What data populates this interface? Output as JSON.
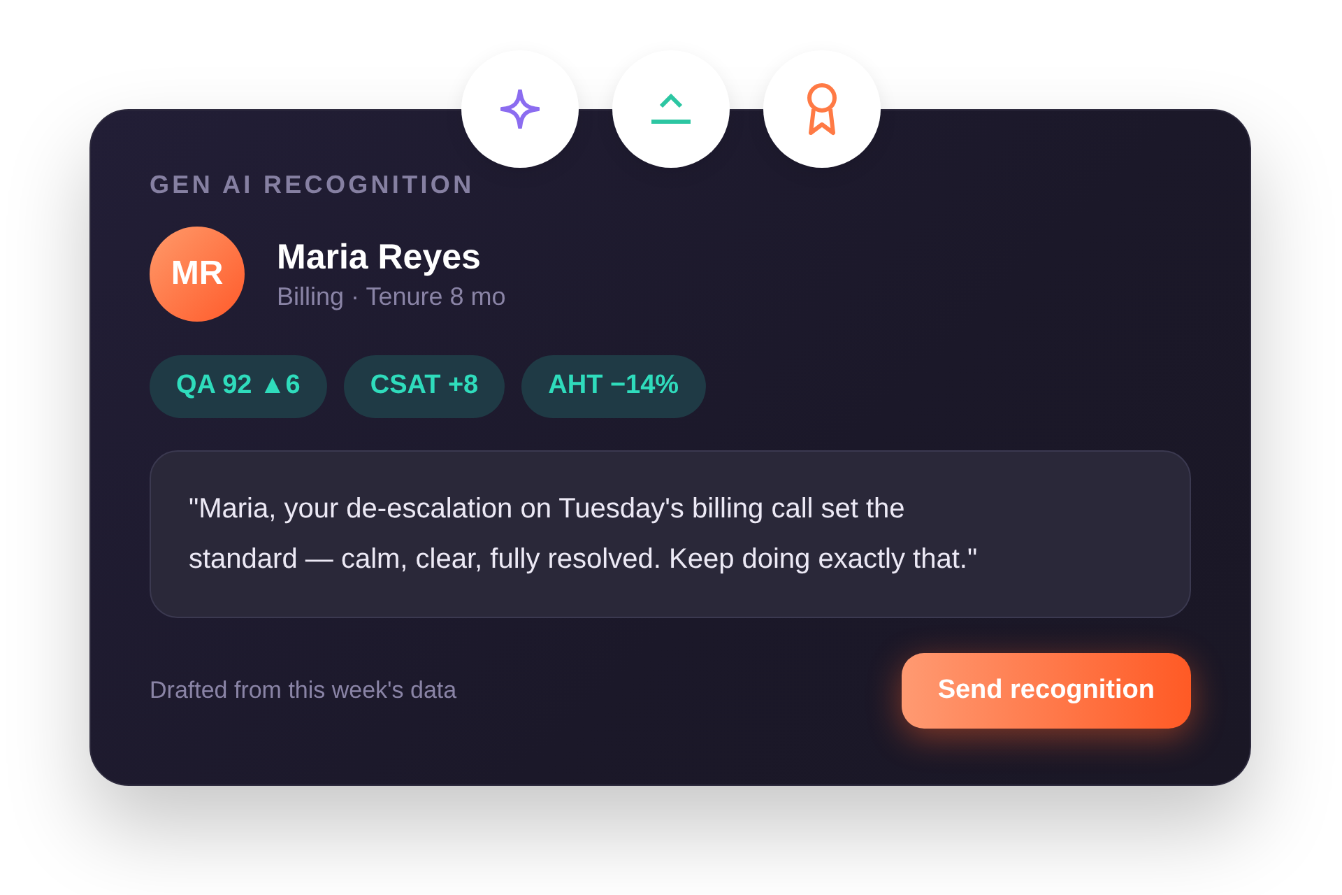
{
  "header_icons": [
    {
      "kind": "sparkle"
    },
    {
      "kind": "trend"
    },
    {
      "kind": "award"
    }
  ],
  "card": {
    "eyebrow": "GEN AI RECOGNITION",
    "person": {
      "initials": "MR",
      "name": "Maria Reyes",
      "subtitle": "Billing · Tenure 8 mo"
    },
    "metrics": [
      {
        "label": "QA 92 ▲6"
      },
      {
        "label": "CSAT +8"
      },
      {
        "label": "AHT −14%"
      }
    ],
    "message": "\"Maria, your de-escalation on Tuesday's billing call set the standard — calm, clear, fully resolved. Keep doing exactly that.\"",
    "footer_note": "Drafted from this week's data",
    "action": "Send recognition"
  }
}
